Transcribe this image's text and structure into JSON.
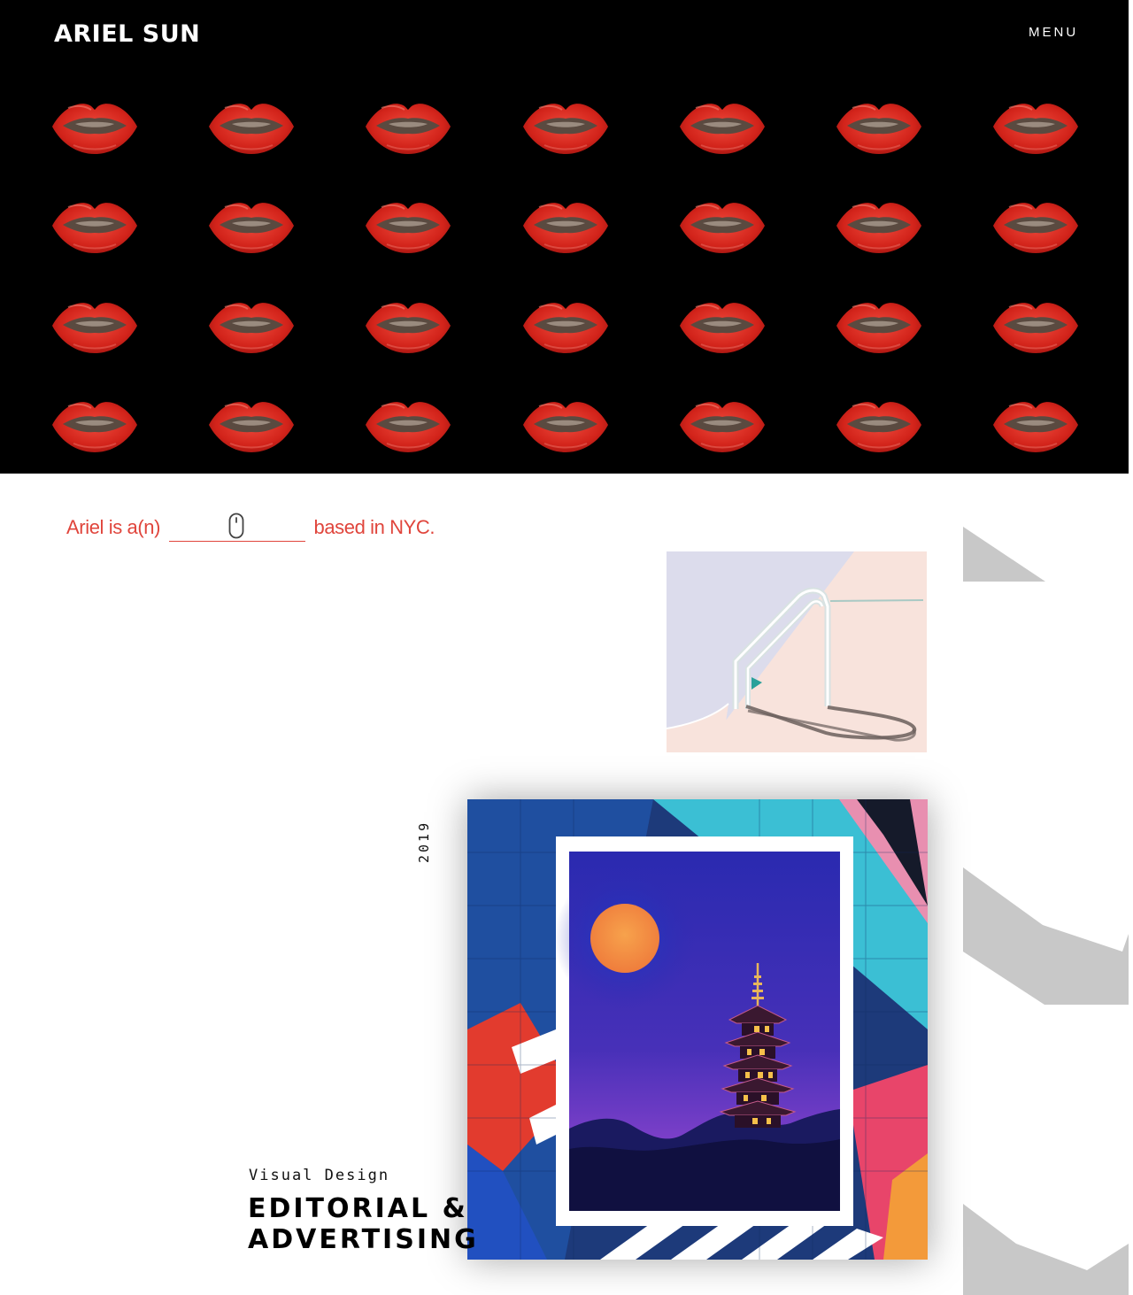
{
  "header": {
    "brand": "ARIEL SUN",
    "menu_label": "MENU"
  },
  "hero": {
    "pattern_icon": "lips-icon",
    "rows": 4,
    "columns": 7,
    "lip_color": "#d9261c"
  },
  "tagline": {
    "prefix": "Ariel is a(n)",
    "suffix": "based in NYC.",
    "blank_icon": "mouse-icon",
    "color": "#e0453c"
  },
  "project": {
    "year": "2019",
    "category": "Visual Design",
    "title_line1": "EDITORIAL &",
    "title_line2": "ADVERTISING"
  },
  "colors": {
    "hero_bg": "#000000",
    "accent": "#e0453c",
    "grey_shape": "#c8c8c8"
  }
}
